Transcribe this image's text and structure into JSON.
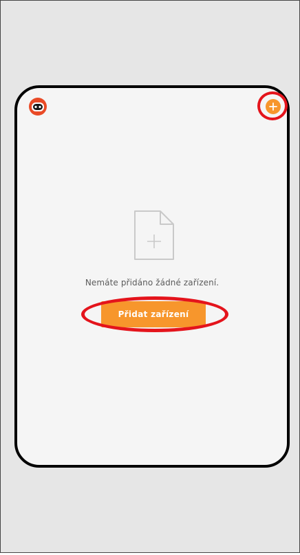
{
  "header": {
    "avatar_icon": "robot-avatar-icon",
    "add_icon": "plus-circle-icon"
  },
  "empty_state": {
    "icon": "add-document-icon",
    "message": "Nemáte přidáno žádné zařízení.",
    "button_label": "Přidat zařízení"
  },
  "colors": {
    "accent": "#f7962c",
    "highlight": "#e4141c",
    "background": "#f5f5f5"
  }
}
